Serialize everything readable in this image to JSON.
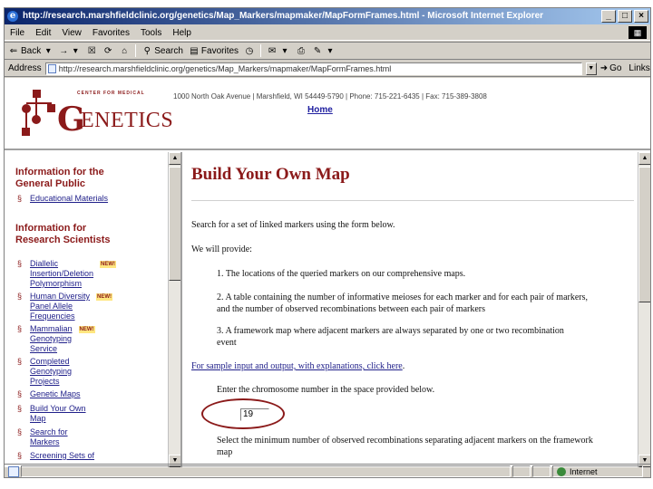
{
  "window": {
    "title": "http://research.marshfieldclinic.org/genetics/Map_Markers/mapmaker/MapFormFrames.html - Microsoft Internet Explorer",
    "buttons": [
      "_",
      "□",
      "×"
    ]
  },
  "menu": [
    "File",
    "Edit",
    "View",
    "Favorites",
    "Tools",
    "Help"
  ],
  "toolbar": {
    "back": "Back",
    "forward": "→",
    "search": "Search",
    "favorites": "Favorites"
  },
  "address": {
    "label": "Address",
    "url": "http://research.marshfieldclinic.org/genetics/Map_Markers/mapmaker/MapFormFrames.html",
    "go": "Go",
    "links": "Links"
  },
  "header": {
    "logo_small": "CENTER FOR MEDICAL",
    "logo_g": "G",
    "logo_rest": "ENETICS",
    "address_line": "1000 North Oak Avenue | Marshfield, WI 54449-5790 | Phone: 715-221-6435 | Fax: 715-389-3808",
    "home": "Home"
  },
  "sidebar": {
    "section1": [
      "Information for the",
      "General Public"
    ],
    "item1": "Educational Materials",
    "section2": [
      "Information for",
      "Research Scientists"
    ],
    "items": [
      {
        "lines": [
          "Diallelic",
          "Insertion/Deletion",
          "Polymorphism"
        ],
        "new": "NEW!"
      },
      {
        "lines": [
          "Human Diversity",
          "Panel Allele",
          "Frequencies"
        ],
        "new": "NEW!"
      },
      {
        "lines": [
          "Mammalian",
          "Genotyping",
          "Service"
        ],
        "new": "NEW!"
      },
      {
        "lines": [
          "Completed",
          "Genotyping",
          "Projects"
        ],
        "new": ""
      },
      {
        "lines": [
          "Genetic Maps"
        ],
        "new": ""
      },
      {
        "lines": [
          "Build Your Own",
          "Map"
        ],
        "new": ""
      },
      {
        "lines": [
          "Search for",
          "Markers"
        ],
        "new": ""
      },
      {
        "lines": [
          "Screening Sets of"
        ],
        "new": ""
      }
    ]
  },
  "main": {
    "title": "Build Your Own Map",
    "intro": "Search for a set of linked markers using the form below.",
    "we_provide": "We will provide:",
    "point1": "1. The locations of the queried markers on our comprehensive maps.",
    "point2a": "2. A table containing the number of informative meioses for each marker and for each pair of markers,",
    "point2b": "and the number of observed recombinations between each pair of markers",
    "point3a": "3. A framework map where adjacent markers are always separated by one or two recombination",
    "point3b": "event",
    "sample_link": "For sample input and output, with explanations, click here",
    "sample_dot": ".",
    "enter_chr": "Enter the chromosome number in the space provided below.",
    "chr_value": "19",
    "select_min_a": "Select the minimum number of observed recombinations separating adjacent markers on the framework",
    "select_min_b": "map"
  },
  "status": {
    "zone": "Internet"
  }
}
